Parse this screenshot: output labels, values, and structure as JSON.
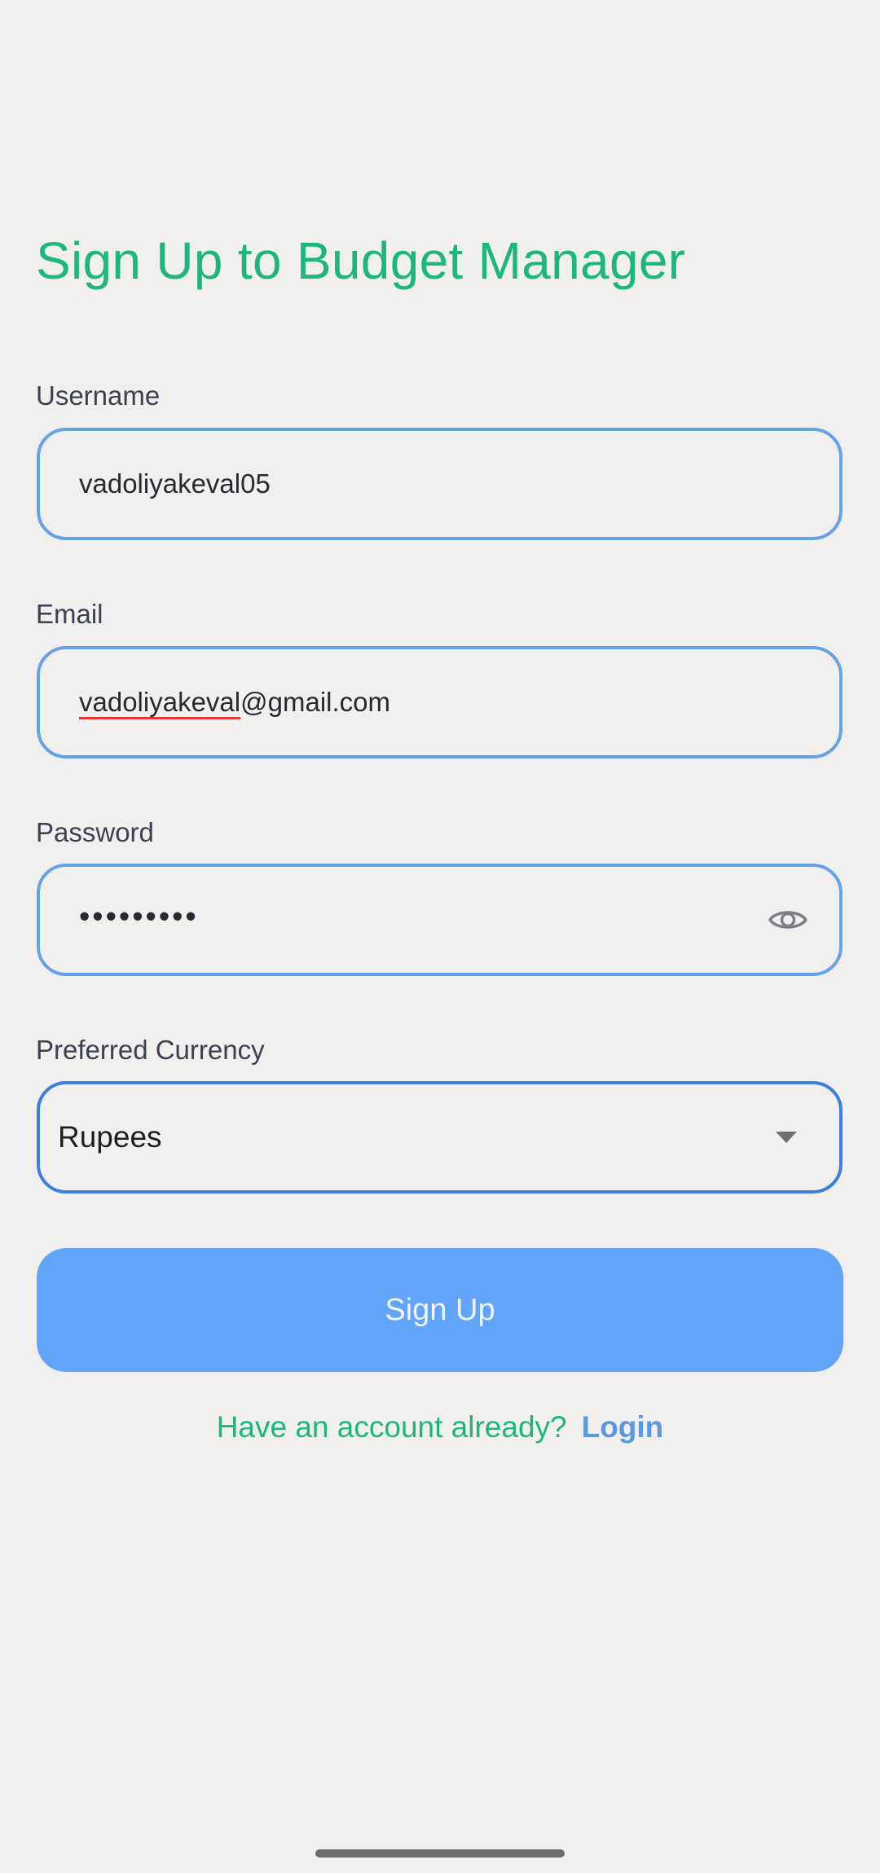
{
  "page": {
    "title": "Sign Up to Budget Manager"
  },
  "form": {
    "username": {
      "label": "Username",
      "value": "vadoliyakeval05"
    },
    "email": {
      "label": "Email",
      "value_misspelled_part": "vadoliyakeval",
      "value_rest": "@gmail.com"
    },
    "password": {
      "label": "Password",
      "masked_value": "•••••••••",
      "visibility_icon": "eye-icon"
    },
    "currency": {
      "label": "Preferred Currency",
      "selected": "Rupees",
      "dropdown_icon": "chevron-down-icon"
    },
    "submit_label": "Sign Up"
  },
  "footer": {
    "prompt": "Have an account already?",
    "login_label": "Login"
  },
  "colors": {
    "title": "#1db77c",
    "field_border": "#67a1e8",
    "select_border": "#3d7fe0",
    "button_bg": "#62a5f8",
    "login_link": "#5b98e0",
    "background": "#f1f0ef"
  }
}
